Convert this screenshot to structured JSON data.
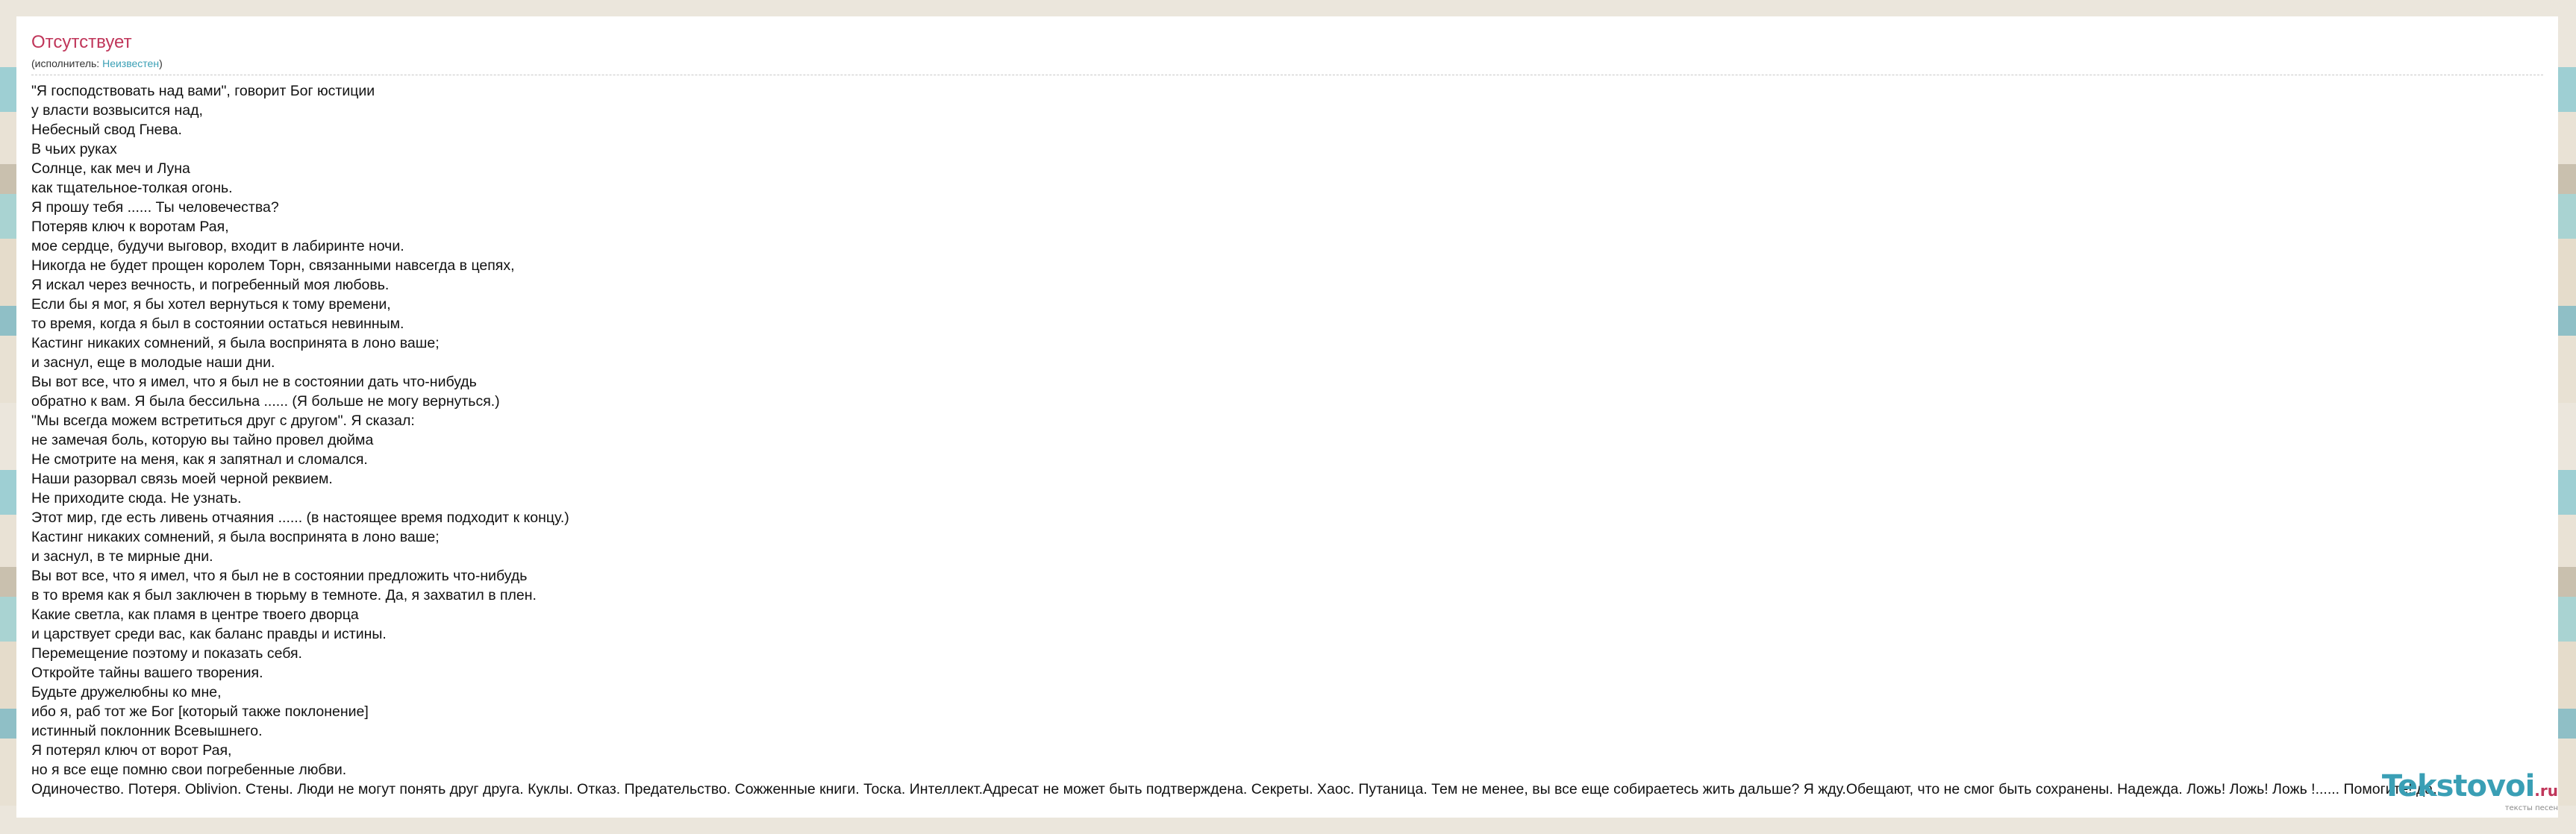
{
  "song": {
    "title": "Отсутствует",
    "performer_prefix": "(исполнитель: ",
    "performer_name": "Неизвестен",
    "performer_suffix": ")"
  },
  "lyrics": [
    "\"Я господствовать над вами\", говорит Бог юстиции",
    "у власти возвысится над,",
    "Небесный свод Гнева.",
    "В чьих руках",
    "Солнце, как меч и Луна",
    "как тщательное-толкая огонь.",
    "Я прошу тебя ...... Ты человечества?",
    "Потеряв ключ к воротам Рая,",
    "мое сердце, будучи выговор, входит в лабиринте ночи.",
    "Никогда не будет прощен королем Торн, связанными навсегда в цепях,",
    "Я искал через вечность, и погребенный моя любовь.",
    "Если бы я мог, я бы хотел вернуться к тому времени,",
    "то время, когда я был в состоянии остаться невинным.",
    "Кастинг никаких сомнений, я была воспринята в лоно ваше;",
    "и заснул, еще в молодые наши дни.",
    "Вы вот все, что я имел, что я был не в состоянии дать что-нибудь",
    "обратно к вам. Я была бессильна ...... (Я больше не могу вернуться.)",
    "\"Мы всегда можем встретиться друг с другом\". Я сказал:",
    "не замечая боль, которую вы тайно провел дюйма",
    "Не смотрите на меня, как я запятнал и сломался.",
    "Наши разорвал связь моей черной реквием.",
    "Не приходите сюда. Не узнать.",
    "Этот мир, где есть ливень отчаяния ...... (в настоящее время подходит к концу.)",
    "Кастинг никаких сомнений, я была воспринята в лоно ваше;",
    "и заснул, в те мирные дни.",
    "Вы вот все, что я имел, что я был не в состоянии предложить что-нибудь",
    "в то время как я был заключен в тюрьму в темноте. Да, я захватил в плен.",
    "Какие светла, как пламя в центре твоего дворца",
    "и царствует среди вас, как баланс правды и истины.",
    "Перемещение поэтому и показать себя.",
    "Откройте тайны вашего творения.",
    "Будьте дружелюбны ко мне,",
    "ибо я, раб тот же Бог [который также поклонение]",
    "истинный поклонник Всевышнего.",
    "Я потерял ключ от ворот Рая,",
    "но я все еще помню свои погребенные любви.",
    "Одиночество. Потеря. Oblivion. Стены. Люди не могут понять друг друга. Куклы. Отказ. Предательство. Сожженные книги. Тоска. Интеллект.Адресат не может быть подтверждена. Секреты. Хаос. Путаница. Тем не менее, вы все еще собираетесь жить дальше? Я жду.Обещают, что не смог быть сохранены. Надежда. Ложь! Ложь! Ложь !...... Помогите! да,"
  ],
  "logo": {
    "name": "Tekstovoi",
    "tld": ".ru",
    "tagline": "тексты песен",
    "brand_color": "#3a9fb5",
    "accent_color": "#c0365a"
  }
}
